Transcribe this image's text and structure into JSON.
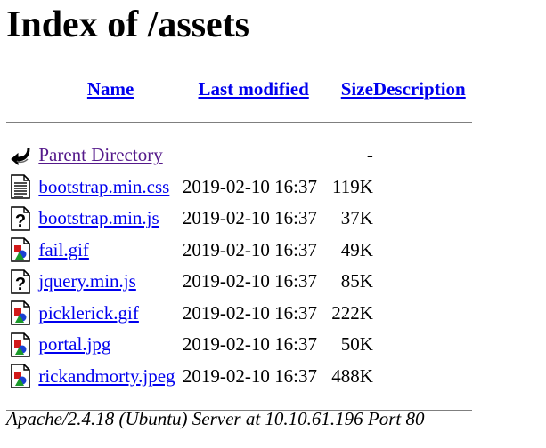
{
  "page": {
    "title": "Index of /assets"
  },
  "headers": {
    "name": "Name",
    "last_modified": "Last modified",
    "size": "Size",
    "description": "Description"
  },
  "rows": [
    {
      "icon": "back-icon",
      "name": "Parent Directory",
      "date": "",
      "size": "-"
    },
    {
      "icon": "text-file-icon",
      "name": "bootstrap.min.css",
      "date": "2019-02-10 16:37",
      "size": "119K"
    },
    {
      "icon": "unknown-file-icon",
      "name": "bootstrap.min.js",
      "date": "2019-02-10 16:37",
      "size": "37K"
    },
    {
      "icon": "image-file-icon",
      "name": "fail.gif",
      "date": "2019-02-10 16:37",
      "size": "49K"
    },
    {
      "icon": "unknown-file-icon",
      "name": "jquery.min.js",
      "date": "2019-02-10 16:37",
      "size": "85K"
    },
    {
      "icon": "image-file-icon",
      "name": "picklerick.gif",
      "date": "2019-02-10 16:37",
      "size": "222K"
    },
    {
      "icon": "image-file-icon",
      "name": "portal.jpg",
      "date": "2019-02-10 16:37",
      "size": "50K"
    },
    {
      "icon": "image-file-icon",
      "name": "rickandmorty.jpeg",
      "date": "2019-02-10 16:37",
      "size": "488K"
    }
  ],
  "footer": {
    "address": "Apache/2.4.18 (Ubuntu) Server at 10.10.61.196 Port 80"
  }
}
